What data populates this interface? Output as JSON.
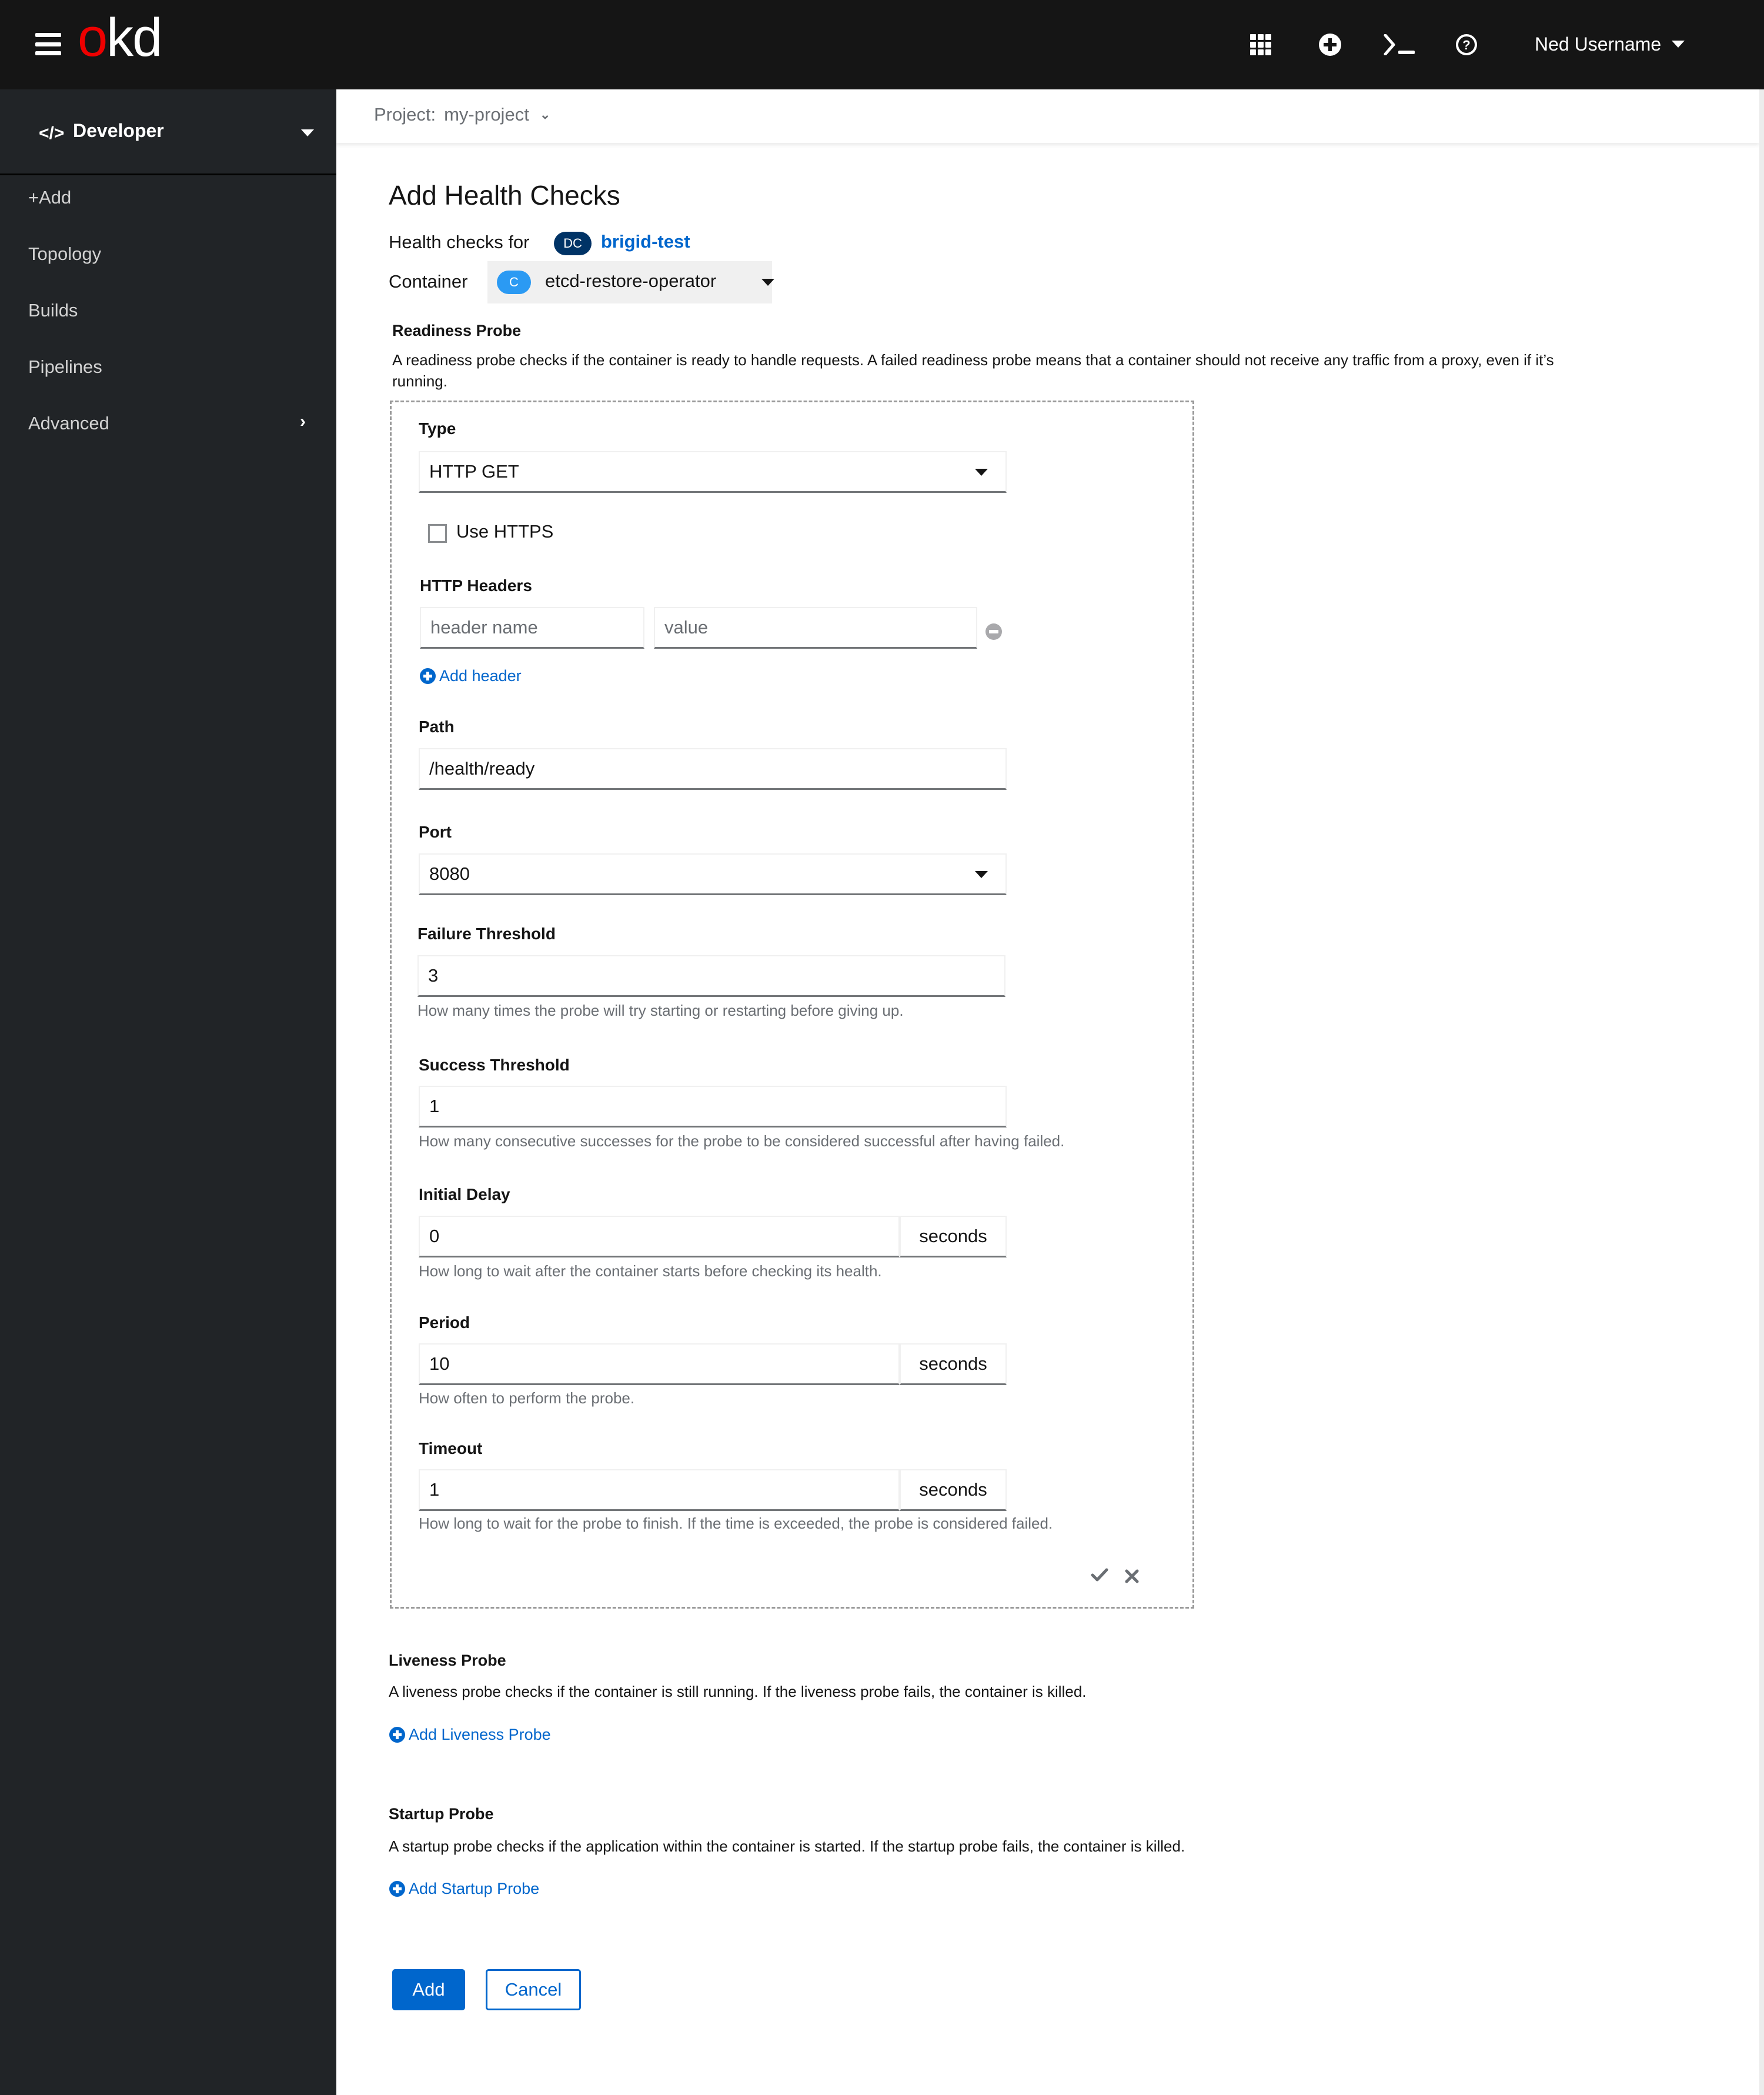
{
  "masthead": {
    "logo_o": "o",
    "logo_rest": "kd",
    "icons": [
      "app-launcher-icon",
      "import-plus-icon",
      "terminal-icon",
      "help-icon"
    ],
    "user_name": "Ned Username"
  },
  "sidebar": {
    "perspective": {
      "icon": "code-icon",
      "label": "Developer"
    },
    "items": [
      {
        "label": "+Add"
      },
      {
        "label": "Topology"
      },
      {
        "label": "Builds"
      },
      {
        "label": "Pipelines"
      },
      {
        "label": "Advanced",
        "has_children": true
      }
    ]
  },
  "project_bar": {
    "label": "Project:",
    "value": "my-project"
  },
  "page": {
    "title": "Add Health Checks",
    "health_checks_for_label": "Health checks for",
    "resource_badge": "DC",
    "resource_name": "brigid-test",
    "container_label": "Container",
    "container_badge": "C",
    "container_value": "etcd-restore-operator"
  },
  "readiness": {
    "title": "Readiness Probe",
    "description_line1": "A readiness probe checks if the container is ready to handle requests. A failed readiness probe means that a container should not receive any traffic from a proxy, even if it’s",
    "description_line2": "running.",
    "type_label": "Type",
    "type_value": "HTTP GET",
    "use_https_label": "Use HTTPS",
    "use_https_checked": false,
    "http_headers_label": "HTTP Headers",
    "header_name_placeholder": "header name",
    "header_value_placeholder": "value",
    "add_header_label": "Add header",
    "path_label": "Path",
    "path_value": "/health/ready",
    "port_label": "Port",
    "port_value": "8080",
    "failure_threshold_label": "Failure Threshold",
    "failure_threshold_value": "3",
    "failure_threshold_help": "How many times the probe will try starting or restarting before giving up.",
    "success_threshold_label": "Success Threshold",
    "success_threshold_value": "1",
    "success_threshold_help": "How many consecutive successes for the probe to be considered successful after having failed.",
    "initial_delay_label": "Initial Delay",
    "initial_delay_value": "0",
    "initial_delay_unit": "seconds",
    "initial_delay_help": "How long to wait after the container starts before checking its health.",
    "period_label": "Period",
    "period_value": "10",
    "period_unit": "seconds",
    "period_help": "How often to perform the probe.",
    "timeout_label": "Timeout",
    "timeout_value": "1",
    "timeout_unit": "seconds",
    "timeout_help": "How long to wait for the probe to finish. If the time is exceeded, the probe is considered failed.",
    "confirm_icon": "check-icon",
    "cancel_icon": "close-icon"
  },
  "liveness": {
    "title": "Liveness Probe",
    "description": "A liveness probe checks if the container is still running. If the liveness probe fails, the container is killed.",
    "add_label": "Add Liveness Probe"
  },
  "startup": {
    "title": "Startup Probe",
    "description": "A startup probe checks if the application within the container is started. If the startup probe fails, the container is killed.",
    "add_label": "Add Startup Probe"
  },
  "actions": {
    "submit_label": "Add",
    "cancel_label": "Cancel"
  },
  "colors": {
    "masthead_bg": "#151515",
    "sidebar_bg": "#212427",
    "primary": "#0066cc",
    "logo_red": "#ee0000",
    "dc_badge": "#003366",
    "c_badge": "#2b9af3"
  }
}
